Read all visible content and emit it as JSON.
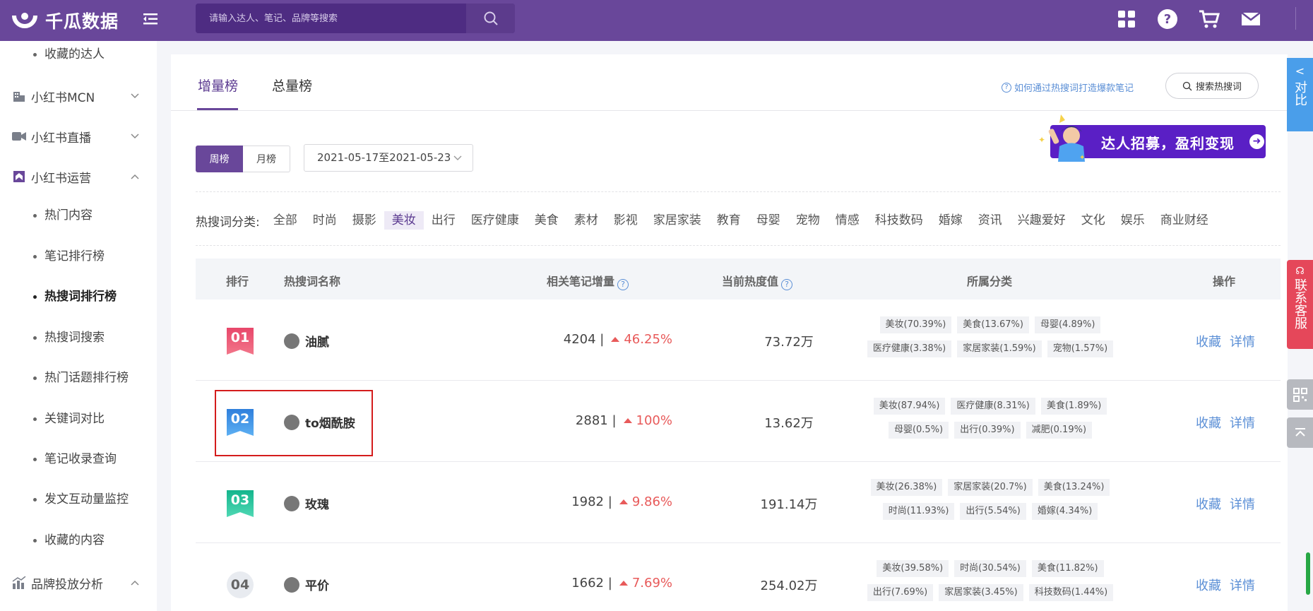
{
  "app": {
    "name": "千瓜数据"
  },
  "search": {
    "placeholder": "请输入达人、笔记、品牌等搜索"
  },
  "sidebar": {
    "top_item": "收藏的达人",
    "groups": [
      {
        "label": "小红书MCN",
        "icon": "building-icon"
      },
      {
        "label": "小红书直播",
        "icon": "video-icon"
      },
      {
        "label": "小红书运营",
        "icon": "bookmark-icon"
      },
      {
        "label": "品牌投放分析",
        "icon": "chart-icon"
      }
    ],
    "items": [
      "热门内容",
      "笔记排行榜",
      "热搜词排行榜",
      "热搜词搜索",
      "热门话题排行榜",
      "关键词对比",
      "笔记收录查询",
      "发文互动量监控",
      "收藏的内容"
    ],
    "active_item": "热搜词排行榜"
  },
  "tabs": {
    "increase": "增量榜",
    "total": "总量榜"
  },
  "help_link": "如何通过热搜词打造爆款笔记",
  "hot_search_button": "搜索热搜词",
  "banner": {
    "text": "达人招募，盈利变现"
  },
  "period": {
    "week": "周榜",
    "month": "月榜",
    "date_range": "2021-05-17至2021-05-23"
  },
  "categories": {
    "label": "热搜词分类:",
    "items": [
      "全部",
      "时尚",
      "摄影",
      "美妆",
      "出行",
      "医疗健康",
      "美食",
      "素材",
      "影视",
      "家居家装",
      "教育",
      "母婴",
      "宠物",
      "情感",
      "科技数码",
      "婚嫁",
      "资讯",
      "兴趣爱好",
      "文化",
      "娱乐",
      "商业财经"
    ],
    "selected": "美妆"
  },
  "table": {
    "headers": {
      "rank": "排行",
      "name": "热搜词名称",
      "growth": "相关笔记增量",
      "heat": "当前热度值",
      "category": "所属分类",
      "ops": "操作"
    },
    "rows": [
      {
        "rank": "01",
        "rank_color": "#e8476a",
        "name": "油腻",
        "count": "4204 |",
        "pct": "46.25%",
        "heat": "73.72万",
        "tags1": [
          "美妆(70.39%)",
          "美食(13.67%)",
          "母婴(4.89%)"
        ],
        "tags2": [
          "医疗健康(3.38%)",
          "家居家装(1.59%)",
          "宠物(1.57%)"
        ]
      },
      {
        "rank": "02",
        "rank_color": "#3d8fe6",
        "name": "to烟酰胺",
        "count": "2881 |",
        "pct": "100%",
        "heat": "13.62万",
        "tags1": [
          "美妆(87.94%)",
          "医疗健康(8.31%)",
          "美食(1.89%)"
        ],
        "tags2": [
          "母婴(0.5%)",
          "出行(0.39%)",
          "减肥(0.19%)"
        ]
      },
      {
        "rank": "03",
        "rank_color": "#1fc39a",
        "name": "玫瑰",
        "count": "1982 |",
        "pct": "9.86%",
        "heat": "191.14万",
        "tags1": [
          "美妆(26.38%)",
          "家居家装(20.7%)",
          "美食(13.24%)"
        ],
        "tags2": [
          "时尚(11.93%)",
          "出行(5.54%)",
          "婚嫁(4.34%)"
        ]
      },
      {
        "rank": "04",
        "rank_color": "#e8ebf0",
        "name": "平价",
        "count": "1662 |",
        "pct": "7.69%",
        "heat": "254.02万",
        "tags1": [
          "美妆(39.58%)",
          "时尚(30.54%)",
          "美食(11.82%)"
        ],
        "tags2": [
          "出行(7.69%)",
          "家居家装(3.45%)",
          "科技数码(1.44%)"
        ]
      }
    ],
    "op_favorite": "收藏",
    "op_detail": "详情"
  },
  "float": {
    "compare": "对比",
    "service": "联系客服"
  },
  "colors": {
    "brand": "#69479a",
    "up": "#e85a5a",
    "link": "#5b8fd6"
  }
}
